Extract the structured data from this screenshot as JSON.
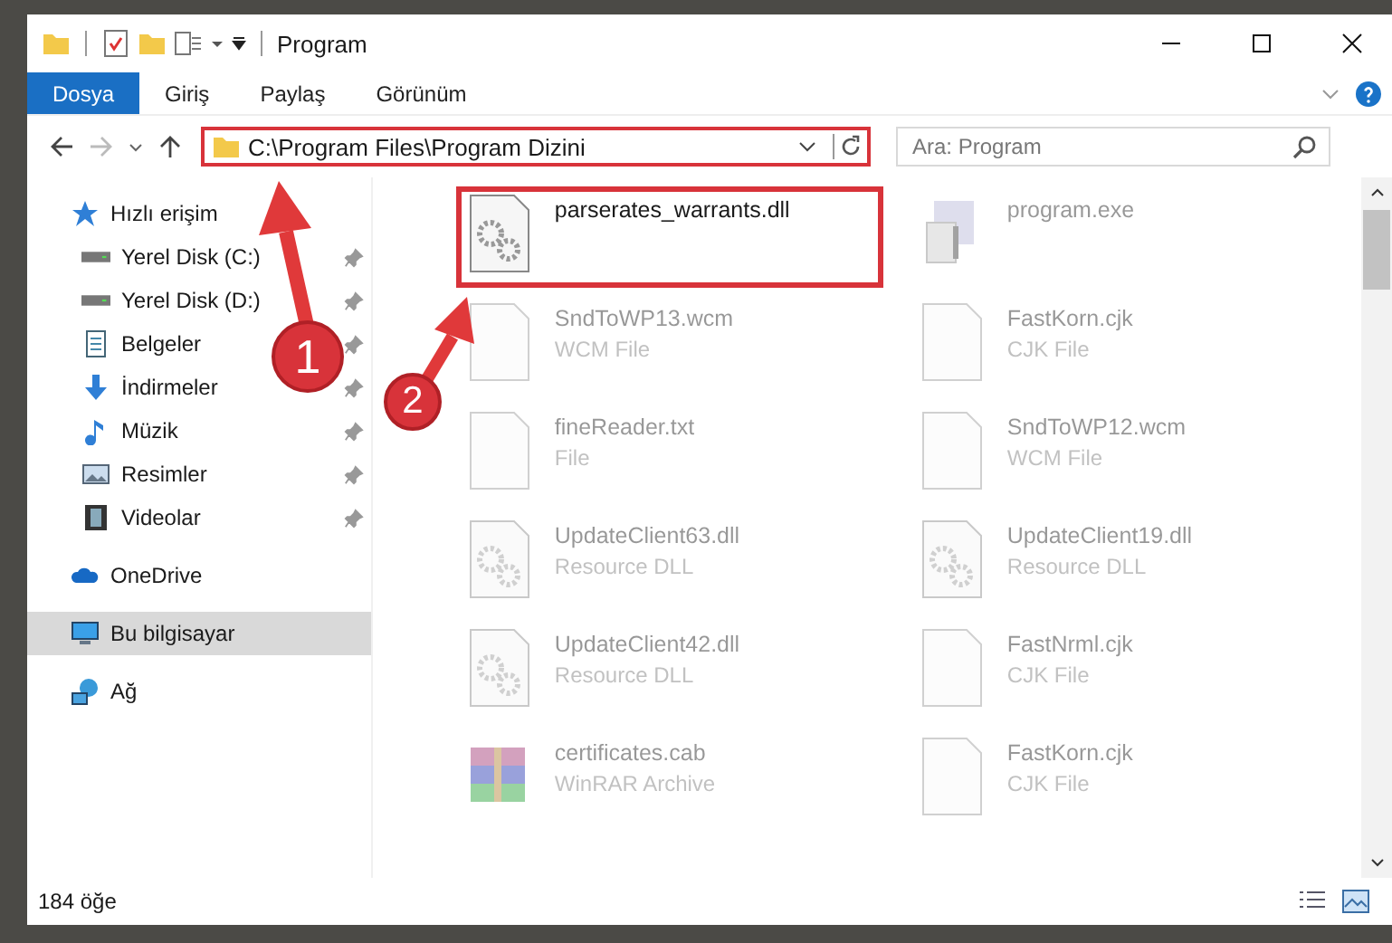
{
  "window": {
    "title": "Program"
  },
  "ribbon_tabs": [
    {
      "label": "Dosya",
      "kind": "file"
    },
    {
      "label": "Giriş",
      "kind": "tab"
    },
    {
      "label": "Paylaş",
      "kind": "tab"
    },
    {
      "label": "Görünüm",
      "kind": "tab"
    }
  ],
  "address_bar": {
    "path": "C:\\Program Files\\Program Dizini"
  },
  "search": {
    "placeholder": "Ara: Program"
  },
  "sidebar": {
    "items": [
      {
        "label": "Hızlı erişim",
        "kind": "star",
        "pinned": false,
        "selected": false,
        "children": [
          {
            "label": "Yerel Disk (C:)",
            "kind": "drive",
            "pinned": true,
            "selected": false
          },
          {
            "label": "Yerel Disk (D:)",
            "kind": "drive",
            "pinned": true,
            "selected": false
          },
          {
            "label": "Belgeler",
            "kind": "docs",
            "pinned": true,
            "selected": false
          },
          {
            "label": "İndirmeler",
            "kind": "download",
            "pinned": true,
            "selected": false
          },
          {
            "label": "Müzik",
            "kind": "music",
            "pinned": true,
            "selected": false
          },
          {
            "label": "Resimler",
            "kind": "pictures",
            "pinned": true,
            "selected": false
          },
          {
            "label": "Videolar",
            "kind": "videos",
            "pinned": true,
            "selected": false
          }
        ]
      },
      {
        "label": "OneDrive",
        "kind": "cloud",
        "pinned": false,
        "selected": false
      },
      {
        "label": "Bu bilgisayar",
        "kind": "computer",
        "pinned": false,
        "selected": true
      },
      {
        "label": "Ağ",
        "kind": "network",
        "pinned": false,
        "selected": false
      }
    ]
  },
  "files": [
    {
      "name": "parserates_warrants.dll",
      "kind": "dll",
      "selected": true
    },
    {
      "name": "program.exe",
      "kind": "exe",
      "selected": false
    },
    {
      "name": "SndToWP13.wcm",
      "type": "WCM File",
      "kind": "generic",
      "selected": false
    },
    {
      "name": "FastKorn.cjk",
      "type": "CJK File",
      "kind": "generic",
      "selected": false
    },
    {
      "name": "fineReader.txt",
      "type": "File",
      "kind": "generic",
      "selected": false
    },
    {
      "name": "SndToWP12.wcm",
      "type": "WCM File",
      "kind": "generic",
      "selected": false
    },
    {
      "name": "UpdateClient63.dll",
      "type": "Resource DLL",
      "kind": "dll",
      "selected": false
    },
    {
      "name": "UpdateClient19.dll",
      "type": "Resource DLL",
      "kind": "dll",
      "selected": false
    },
    {
      "name": "UpdateClient42.dll",
      "type": "Resource DLL",
      "kind": "dll",
      "selected": false
    },
    {
      "name": "FastNrml.cjk",
      "type": "CJK File",
      "kind": "generic",
      "selected": false
    },
    {
      "name": "certificates.cab",
      "type": "WinRAR Archive",
      "kind": "cab",
      "selected": false
    },
    {
      "name": "FastKorn.cjk",
      "type": "CJK File",
      "kind": "generic",
      "selected": false
    }
  ],
  "status_bar": {
    "count": "184 öğe"
  },
  "annotations": [
    {
      "label": "1"
    },
    {
      "label": "2"
    }
  ]
}
